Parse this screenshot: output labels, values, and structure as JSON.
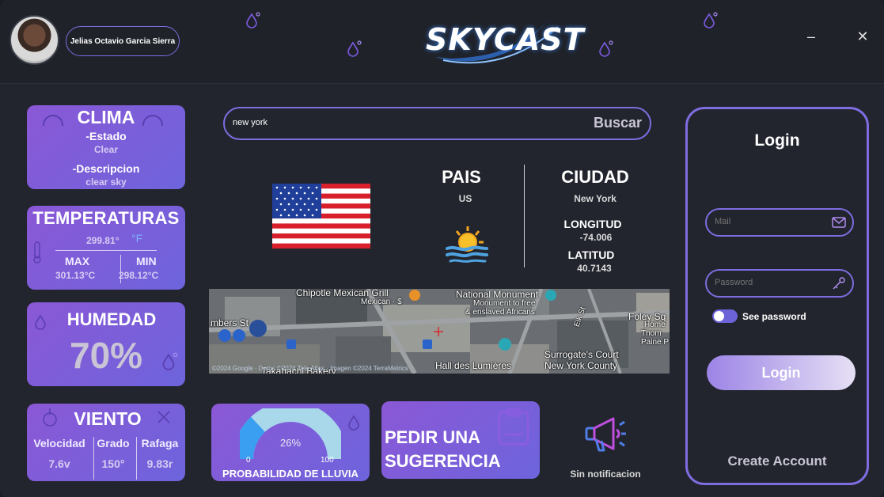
{
  "user": {
    "name": "Jelias Octavio Garcia Sierra"
  },
  "app": {
    "logo_text": "SKYCAST"
  },
  "window": {
    "minimize_glyph": "–",
    "close_glyph": "✕"
  },
  "clima": {
    "title": "CLIMA",
    "estado_label": "-Estado",
    "estado_value": "Clear",
    "descripcion_label": "-Descripcion",
    "descripcion_value": "clear sky"
  },
  "temperaturas": {
    "title": "TEMPERATURAS",
    "average": "299.81°",
    "unit": "°F",
    "max_label": "MAX",
    "min_label": "MIN",
    "max_value": "301.13°C",
    "min_value": "298.12°C"
  },
  "humedad": {
    "title": "HUMEDAD",
    "value": "70%"
  },
  "viento": {
    "title": "VIENTO",
    "velocidad_label": "Velocidad",
    "velocidad_value": "7.6v",
    "grado_label": "Grado",
    "grado_value": "150°",
    "rafaga_label": "Rafaga",
    "rafaga_value": "9.83r"
  },
  "search": {
    "value": "new york",
    "button_label": "Buscar"
  },
  "location": {
    "pais_label": "PAIS",
    "pais_value": "US",
    "ciudad_label": "CIUDAD",
    "ciudad_value": "New York",
    "longitud_label": "LONGITUD",
    "longitud_value": "-74.006",
    "latitud_label": "LATITUD",
    "latitud_value": "40.7143"
  },
  "map": {
    "labels": {
      "chipotle": "Chipotle Mexican Grill",
      "mexican": "Mexican · $",
      "national": "National Monument",
      "monument_free": "Monument to free",
      "enslaved": "& enslaved Africans",
      "foley": "Foley Sq",
      "home": "Home",
      "thom": "Thom",
      "paine": "Paine P",
      "chambers": "mbers St",
      "surrogate": "Surrogate's Court",
      "ny_county": "New York County",
      "halls": "Hall des Lumières",
      "takahachi": "Takahachi Bakery",
      "elk": "Elk St"
    },
    "attribution": "©2024 Google · Datos ©2024 Tele Atlas · Imagen ©2024 TerraMetrics"
  },
  "rain": {
    "percent": 26,
    "percent_label": "26%",
    "min_label": "0",
    "max_label": "100",
    "title": "PROBABILIDAD DE LLUVIA"
  },
  "suggestion": {
    "line1": "PEDIR UNA",
    "line2": "SUGERENCIA"
  },
  "notification": {
    "text": "Sin notificacion"
  },
  "login": {
    "title": "Login",
    "mail_placeholder": "Mail",
    "password_placeholder": "Password",
    "see_password_label": "See password",
    "login_button": "Login",
    "create_account": "Create Account"
  },
  "colors": {
    "accent": "#7f6ce0",
    "card_start": "#8b58d6",
    "card_end": "#6d64dc",
    "background": "#22252d"
  }
}
